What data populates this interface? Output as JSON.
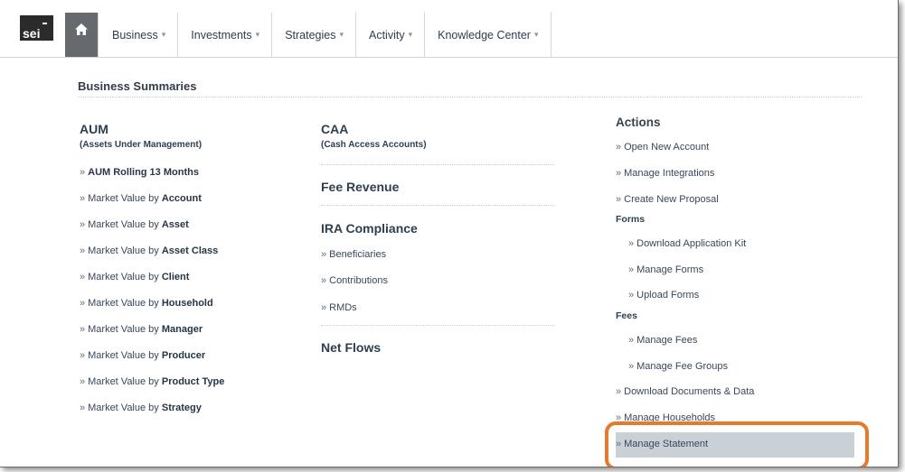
{
  "nav": {
    "logo_text": "sei",
    "items": [
      {
        "label": "Business"
      },
      {
        "label": "Investments"
      },
      {
        "label": "Strategies"
      },
      {
        "label": "Activity"
      },
      {
        "label": "Knowledge Center"
      }
    ],
    "caret": "▾",
    "home_icon": "home-icon"
  },
  "section": {
    "title": "Business Summaries"
  },
  "aum": {
    "title": "AUM",
    "subtitle": "(Assets Under Management)",
    "rolling": "AUM Rolling 13 Months",
    "prefix": "Market Value by",
    "items": [
      "Account",
      "Asset",
      "Asset Class",
      "Client",
      "Household",
      "Manager",
      "Producer",
      "Product Type",
      "Strategy"
    ]
  },
  "col2": {
    "caa_title": "CAA",
    "caa_subtitle": "(Cash Access Accounts)",
    "fee_revenue": "Fee Revenue",
    "ira_title": "IRA Compliance",
    "ira_items": [
      "Beneficiaries",
      "Contributions",
      "RMDs"
    ],
    "net_flows": "Net Flows"
  },
  "actions": {
    "title": "Actions",
    "open_new_account": "Open New Account",
    "manage_integrations": "Manage Integrations",
    "create_new_proposal": "Create New Proposal",
    "forms_title": "Forms",
    "download_application_kit": "Download Application Kit",
    "manage_forms": "Manage Forms",
    "upload_forms": "Upload Forms",
    "fees_title": "Fees",
    "manage_fees": "Manage Fees",
    "manage_fee_groups": "Manage Fee Groups",
    "download_documents": "Download Documents & Data",
    "manage_households": "Manage Households",
    "manage_statement": "Manage Statement"
  },
  "chevron": "»",
  "colors": {
    "highlight_border": "#e8782a",
    "highlight_bg": "#c9d0d6",
    "home_bg": "#666a6e"
  }
}
